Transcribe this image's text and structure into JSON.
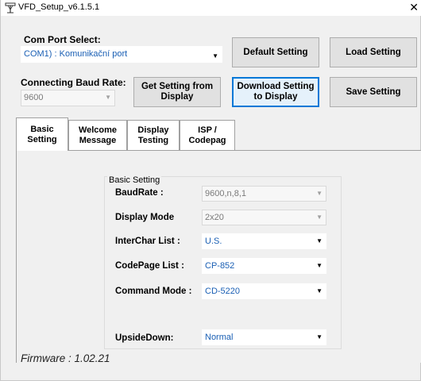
{
  "window": {
    "title": "VFD_Setup_v6.1.5.1",
    "close_glyph": "✕"
  },
  "com_port": {
    "label": "Com Port Select:",
    "value": "COM1) : Komunikační port"
  },
  "baud": {
    "label": "Connecting Baud Rate:",
    "value": "9600"
  },
  "buttons": {
    "default_setting": "Default Setting",
    "load_setting": "Load Setting",
    "get_setting_line1": "Get Setting from",
    "get_setting_line2": "Display",
    "download_setting_line1": "Download Setting",
    "download_setting_line2": "to Display",
    "save_setting": "Save Setting"
  },
  "tabs": [
    {
      "line1": "Basic",
      "line2": "Setting"
    },
    {
      "line1": "Welcome",
      "line2": "Message"
    },
    {
      "line1": "Display",
      "line2": "Testing"
    },
    {
      "line1": "ISP /",
      "line2": "Codepag"
    }
  ],
  "basic_setting": {
    "group_title": "Basic Setting",
    "fields": [
      {
        "label": "BaudRate :",
        "value": "9600,n,8,1"
      },
      {
        "label": "Display Mode",
        "value": "2x20"
      },
      {
        "label": "InterChar  List :",
        "value": "U.S."
      },
      {
        "label": "CodePage List :",
        "value": "CP-852"
      },
      {
        "label": "Command Mode :",
        "value": "CD-5220"
      },
      {
        "label": "UpsideDown:",
        "value": "Normal"
      }
    ]
  },
  "firmware": "Firmware : 1.02.21",
  "icons": {
    "app": "network-tower-icon",
    "dropdown": "dropdown-arrow-icon",
    "close": "close-icon"
  },
  "colors": {
    "accent": "#0078d7",
    "value_text": "#1a5fb4",
    "window_bg": "#f0f0f0"
  }
}
